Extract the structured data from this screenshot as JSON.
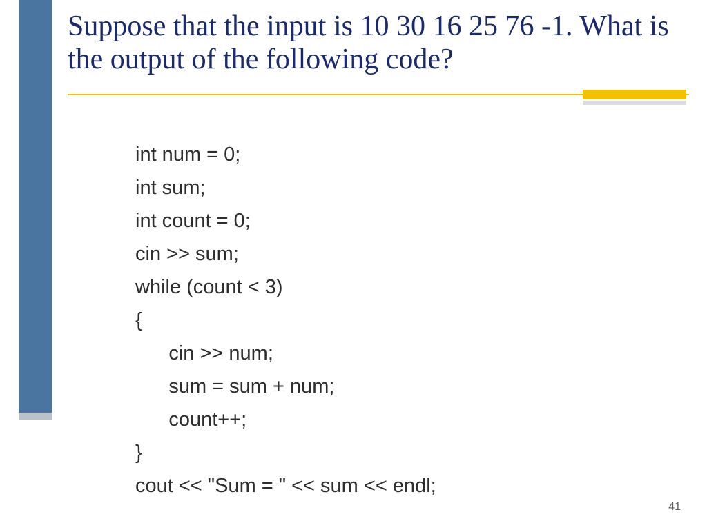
{
  "title": "Suppose that the input is 10 30 16 25 76 -1. What is the output of the following code?",
  "code": {
    "l1": "int num = 0;",
    "l2": "int sum;",
    "l3": "int count = 0;",
    "l4": "cin >> sum;",
    "l5": "while (count < 3)",
    "l6": "{",
    "l7": "      cin >> num;",
    "l8": "      sum = sum + num;",
    "l9": "      count++;",
    "l10": "}",
    "l11": "cout << \"Sum = \" << sum << endl;"
  },
  "page_number": "41"
}
